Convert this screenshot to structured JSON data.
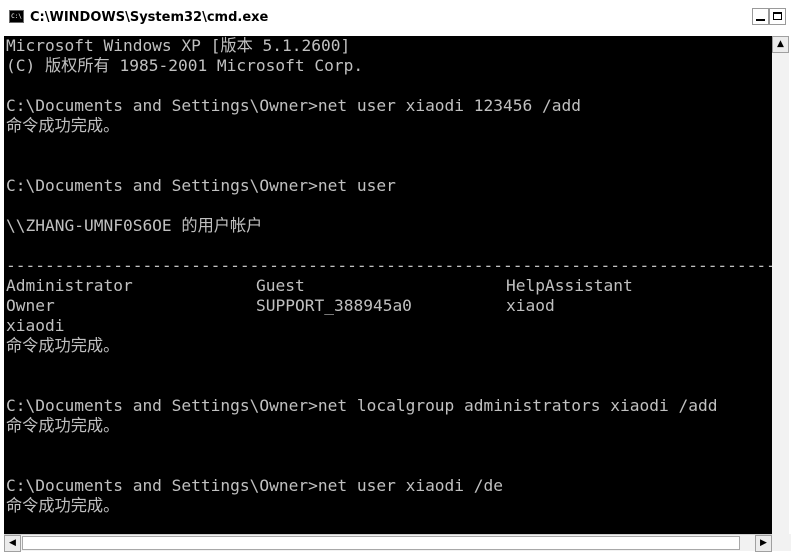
{
  "window": {
    "title": "C:\\WINDOWS\\System32\\cmd.exe",
    "icon": "cmd-icon",
    "icon_label": "C:\\"
  },
  "console": {
    "lines": [
      "Microsoft Windows XP [版本 5.1.2600]",
      "(C) 版权所有 1985-2001 Microsoft Corp.",
      "",
      "C:\\Documents and Settings\\Owner>net user xiaodi 123456 /add",
      "命令成功完成。",
      "",
      "",
      "C:\\Documents and Settings\\Owner>net user",
      "",
      "\\\\ZHANG-UMNF0S6OE 的用户帐户",
      "",
      "-------------------------------------------------------------------------------",
      "",
      "",
      "xiaodi",
      "命令成功完成。",
      "",
      "",
      "C:\\Documents and Settings\\Owner>net localgroup administrators xiaodi /add",
      "命令成功完成。",
      "",
      "",
      "C:\\Documents and Settings\\Owner>net user xiaodi /de",
      "命令成功完成。"
    ],
    "user_table": [
      [
        "Administrator",
        "Guest",
        "HelpAssistant"
      ],
      [
        "Owner",
        "SUPPORT_388945a0",
        "xiaod"
      ]
    ]
  },
  "scrollbar": {
    "up_arrow": "▲",
    "left_arrow": "◀",
    "right_arrow": "▶"
  },
  "colors": {
    "console_bg": "#000000",
    "console_text": "#c0c0c0"
  }
}
